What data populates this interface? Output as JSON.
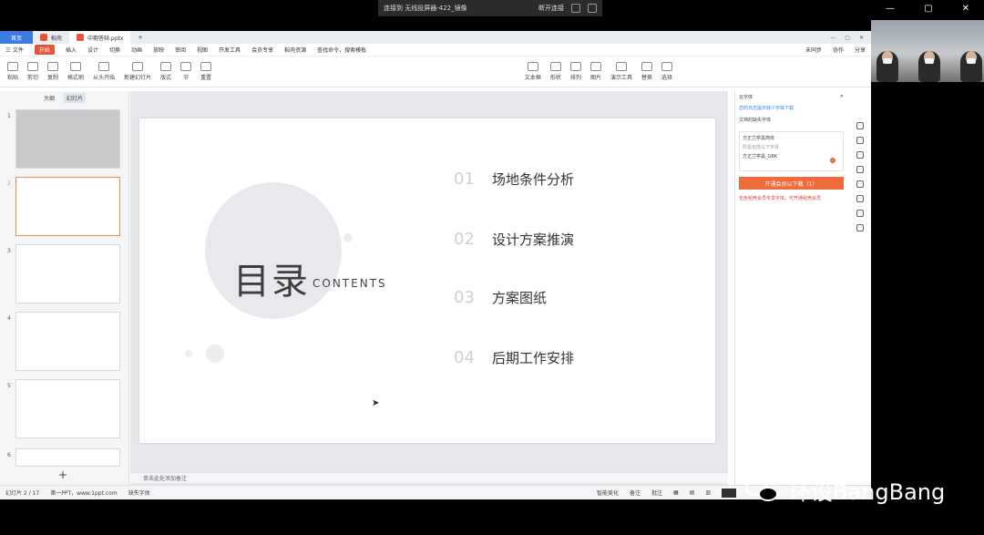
{
  "remote": {
    "title": "连接到 无线投屏器-422_镜像",
    "disconnect": "断开连接"
  },
  "tabs": {
    "home": "首页",
    "template": "稻壳",
    "file": "中期答辩.pptx",
    "add": "+"
  },
  "menu": {
    "file": "三 文件",
    "items": [
      "开始",
      "插入",
      "设计",
      "切换",
      "动画",
      "放映",
      "审阅",
      "视图",
      "开发工具",
      "会员专享",
      "稻壳资源"
    ],
    "search": "查找命令、搜索模板",
    "sync": "未同步",
    "collab": "协作",
    "share": "分享"
  },
  "ribbon": {
    "items": [
      "粘贴",
      "剪切",
      "复制",
      "格式刷",
      "从头开始",
      "新建幻灯片",
      "版式",
      "节",
      "重置",
      "文本框",
      "形状",
      "排列",
      "图片",
      "演示工具",
      "替换",
      "选择"
    ]
  },
  "left_panel": {
    "tab_outline": "大纲",
    "tab_slides": "幻灯片",
    "thumb_numbers": [
      "1",
      "2",
      "3",
      "4",
      "5",
      "6"
    ],
    "add": "+"
  },
  "slide": {
    "title": "目录",
    "subtitle": "CONTENTS",
    "items": [
      {
        "num": "01",
        "text": "场地条件分析"
      },
      {
        "num": "02",
        "text": "设计方案推演"
      },
      {
        "num": "03",
        "text": "方案图纸"
      },
      {
        "num": "04",
        "text": "后期工作安排"
      }
    ]
  },
  "notes_placeholder": "单击此处添加备注",
  "right_panel": {
    "header": "云字体",
    "link": "您的日志提示缺少字体下载",
    "section": "文档的缺失字体",
    "font1": "方正兰亭黑简体",
    "hint": "所需包括以下字体",
    "font2": "方正兰亭黑_GBK",
    "button": "开通会员以下载（1）",
    "warn": "包含稻壳会员专享字体，可开通稻壳会员"
  },
  "status": {
    "slide_counter": "幻灯片 2 / 17",
    "template": "第一PPT，www.1ppt.com",
    "font_missing": "缺失字体",
    "beautify": "智能美化",
    "notes": "备注",
    "comments": "批注"
  },
  "watermark": "环设BangBang"
}
